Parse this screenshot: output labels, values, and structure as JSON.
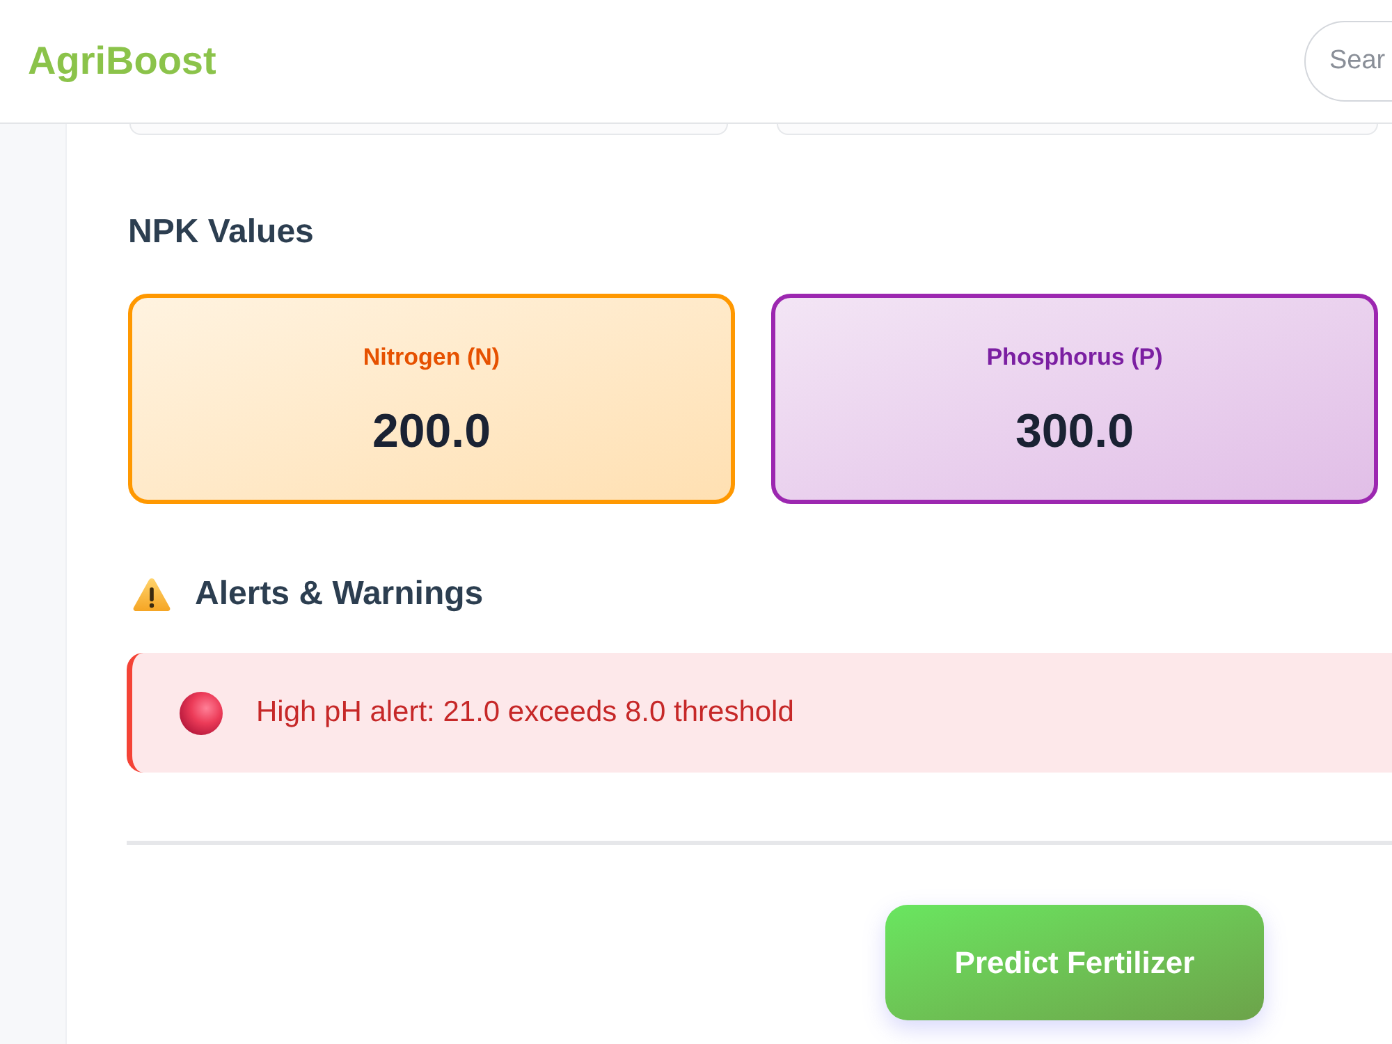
{
  "header": {
    "logo": "AgriBoost",
    "search": {
      "placeholder": "Sear"
    }
  },
  "npk": {
    "title": "NPK Values",
    "nutrients": [
      {
        "kind": "nitrogen",
        "label": "Nitrogen (N)",
        "value": "200.0"
      },
      {
        "kind": "phosphorus",
        "label": "Phosphorus (P)",
        "value": "300.0"
      }
    ]
  },
  "alerts": {
    "title": "Alerts & Warnings",
    "items": [
      {
        "text": "High pH alert: 21.0 exceeds 8.0 threshold"
      }
    ]
  },
  "action": {
    "label": "Predict Fertilizer"
  }
}
